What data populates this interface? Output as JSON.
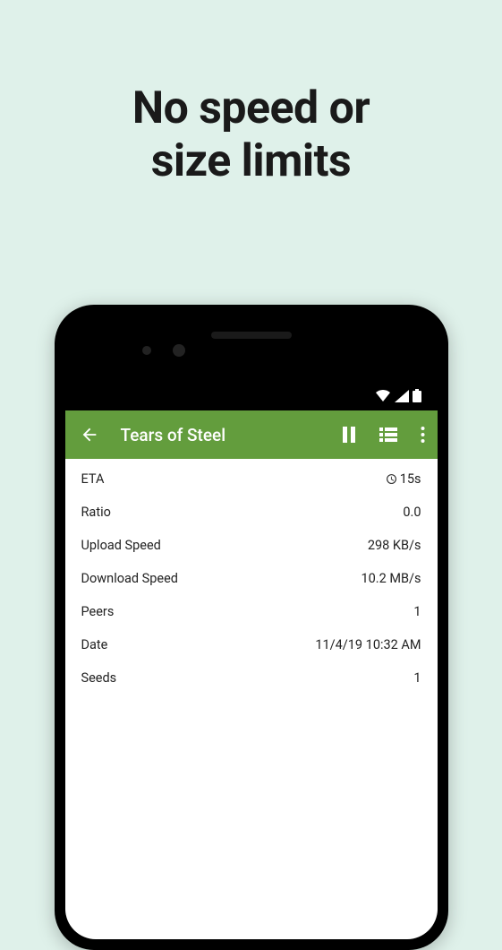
{
  "headline_line1": "No speed or",
  "headline_line2": "size limits",
  "appbar": {
    "title": "Tears of Steel"
  },
  "rows": [
    {
      "label": "ETA",
      "value": "15s",
      "hasClock": true
    },
    {
      "label": "Ratio",
      "value": "0.0",
      "hasClock": false
    },
    {
      "label": "Upload Speed",
      "value": "298 KB/s",
      "hasClock": false
    },
    {
      "label": "Download Speed",
      "value": "10.2 MB/s",
      "hasClock": false
    },
    {
      "label": "Peers",
      "value": "1",
      "hasClock": false
    },
    {
      "label": "Date",
      "value": "11/4/19 10:32 AM",
      "hasClock": false
    },
    {
      "label": "Seeds",
      "value": "1",
      "hasClock": false
    }
  ]
}
